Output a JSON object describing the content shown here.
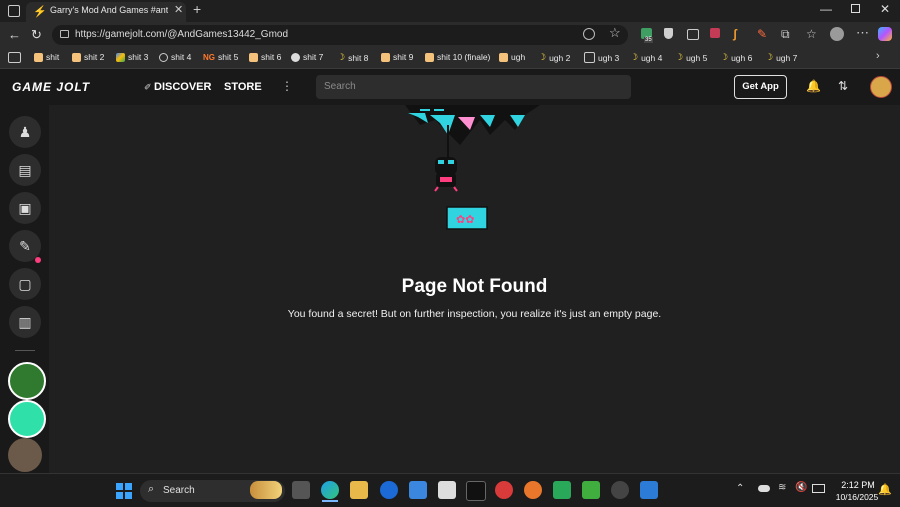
{
  "browser": {
    "tab_title": "Garry's Mod And Games #antigna",
    "url": "https://gamejolt.com/@AndGames13442_Gmod",
    "bookmarks": [
      "shit",
      "shit 2",
      "shit 3",
      "shit 4",
      "shit 5",
      "shit 6",
      "shit 7",
      "shit 8",
      "shit 9",
      "shit 10 (finale)",
      "ugh",
      "ugh 2",
      "ugh 3",
      "ugh 4",
      "ugh 5",
      "ugh 6",
      "ugh 7"
    ],
    "extension_badge": "35"
  },
  "gamejolt": {
    "logo": "GAME JOLT",
    "nav": {
      "discover": "DISCOVER",
      "store": "STORE"
    },
    "search_placeholder": "Search",
    "get_app": "Get App"
  },
  "page": {
    "title": "Page Not Found",
    "message": "You found a secret! But on further inspection, you realize it's just an empty page."
  },
  "taskbar": {
    "search_label": "Search",
    "time": "2:12 PM",
    "date": "10/16/2025"
  },
  "colors": {
    "background": "#202020",
    "nav": "#191919",
    "accent_teal": "#2fd4e0",
    "accent_pink": "#ff3d7f"
  }
}
